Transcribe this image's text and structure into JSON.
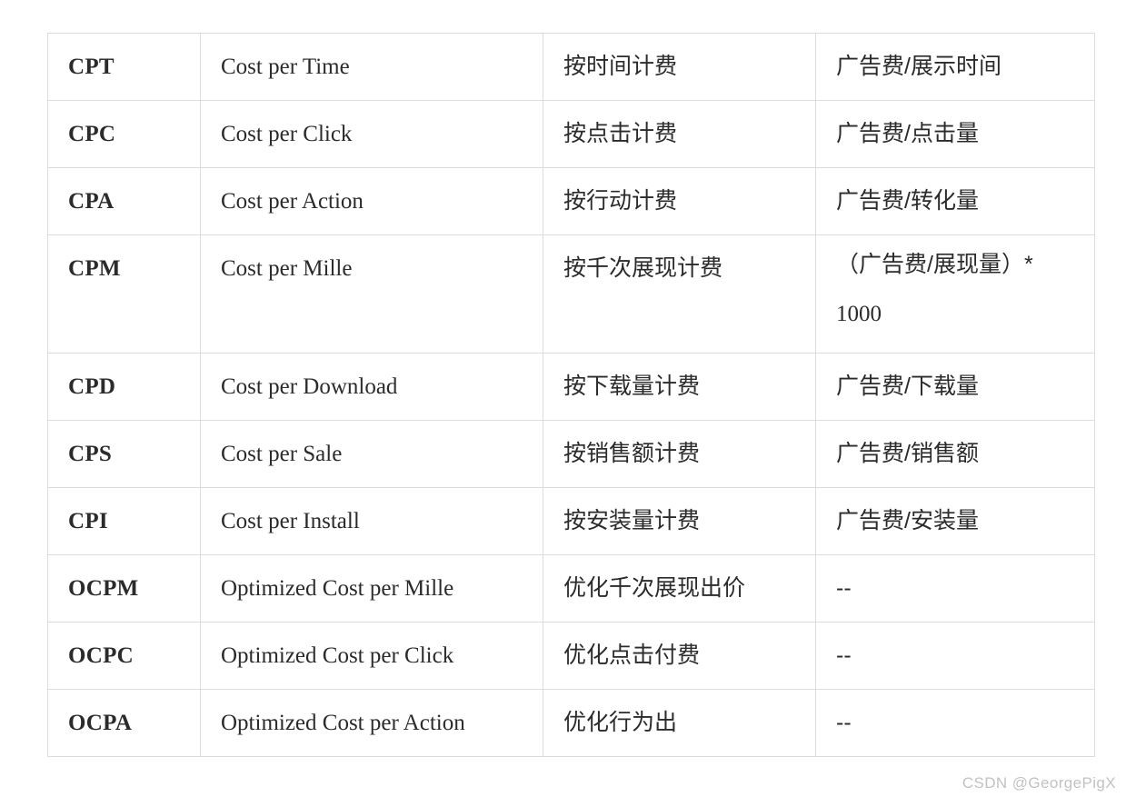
{
  "table": {
    "columns": [
      "abbr",
      "full_name",
      "chinese_name",
      "formula"
    ],
    "rows": [
      {
        "abbr": "CPT",
        "full_name": "Cost per Time",
        "chinese_name": "按时间计费",
        "formula": "广告费/展示时间",
        "tall": false
      },
      {
        "abbr": "CPC",
        "full_name": "Cost per Click",
        "chinese_name": "按点击计费",
        "formula": "广告费/点击量",
        "tall": false
      },
      {
        "abbr": "CPA",
        "full_name": "Cost per Action",
        "chinese_name": "按行动计费",
        "formula": "广告费/转化量",
        "tall": false
      },
      {
        "abbr": "CPM",
        "full_name": "Cost per Mille",
        "chinese_name": "按千次展现计费",
        "formula_line1": "（广告费/展现量）*",
        "formula_line2": "1000",
        "tall": true
      },
      {
        "abbr": "CPD",
        "full_name": "Cost per Download",
        "chinese_name": "按下载量计费",
        "formula": "广告费/下载量",
        "tall": false
      },
      {
        "abbr": "CPS",
        "full_name": "Cost per Sale",
        "chinese_name": "按销售额计费",
        "formula": "广告费/销售额",
        "tall": false
      },
      {
        "abbr": "CPI",
        "full_name": "Cost per Install",
        "chinese_name": "按安装量计费",
        "formula": "广告费/安装量",
        "tall": false
      },
      {
        "abbr": "OCPM",
        "full_name": "Optimized Cost per Mille",
        "chinese_name": "优化千次展现出价",
        "formula": "--",
        "tall": false
      },
      {
        "abbr": "OCPC",
        "full_name": "Optimized Cost per Click",
        "chinese_name": "优化点击付费",
        "formula": "--",
        "tall": false
      },
      {
        "abbr": "OCPA",
        "full_name": "Optimized Cost per Action",
        "chinese_name": "优化行为出",
        "formula": "--",
        "tall": false
      }
    ]
  },
  "watermark": {
    "text": "CSDN @GeorgePigX"
  },
  "colors": {
    "border": "#dcdcdc",
    "text": "#2b2b2b",
    "watermark": "#c2c2c2",
    "background": "#ffffff"
  }
}
